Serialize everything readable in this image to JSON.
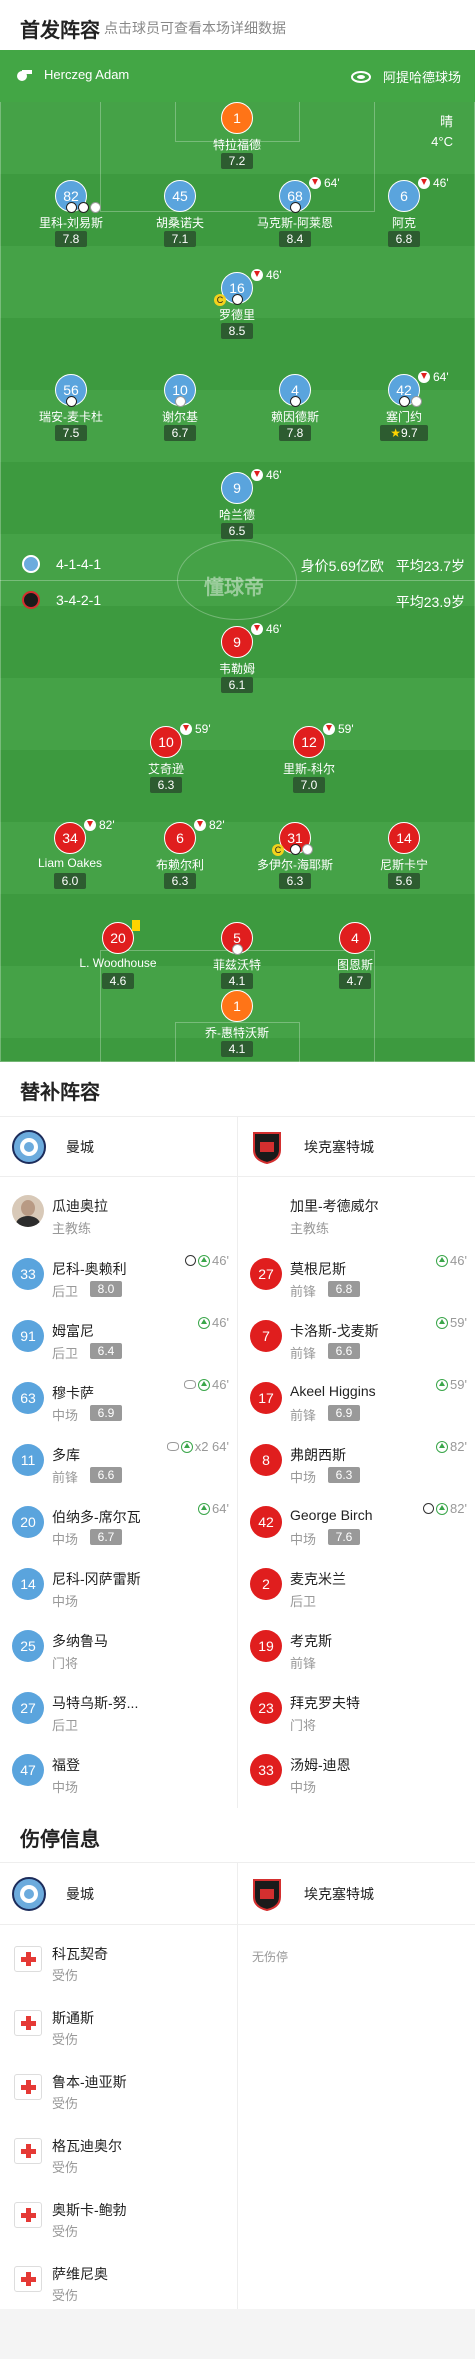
{
  "header": {
    "title": "首发阵容",
    "subtitle": "点击球员可查看本场详细数据"
  },
  "pitch": {
    "referee": "Herczeg Adam",
    "stadium": "阿提哈德球场",
    "weather": {
      "condition": "晴",
      "temperature": "4°C"
    },
    "watermark": "懂球帝",
    "home_team": {
      "name": "曼城",
      "formation": "4-1-4-1",
      "value": "身价5.69亿欧",
      "age": "平均23.7岁"
    },
    "away_team": {
      "name": "埃克塞特城",
      "formation": "3-4-2-1",
      "age": "平均23.9岁"
    },
    "home_players": [
      {
        "num": "1",
        "name": "特拉福德",
        "rating": "7.2",
        "color": "orange"
      },
      {
        "num": "82",
        "name": "里科-刘易斯",
        "rating": "7.8",
        "color": "blue"
      },
      {
        "num": "45",
        "name": "胡桑诺夫",
        "rating": "7.1",
        "color": "blue"
      },
      {
        "num": "68",
        "name": "马克斯-阿莱恩",
        "rating": "8.4",
        "color": "blue",
        "sub": "64'"
      },
      {
        "num": "6",
        "name": "阿克",
        "rating": "6.8",
        "color": "blue",
        "sub": "46'"
      },
      {
        "num": "16",
        "name": "罗德里",
        "rating": "8.5",
        "color": "blue",
        "sub": "46'"
      },
      {
        "num": "56",
        "name": "瑞安-麦卡杜",
        "rating": "7.5",
        "color": "blue"
      },
      {
        "num": "10",
        "name": "谢尔基",
        "rating": "6.7",
        "color": "blue"
      },
      {
        "num": "4",
        "name": "赖因德斯",
        "rating": "7.8",
        "color": "blue"
      },
      {
        "num": "42",
        "name": "塞门约",
        "rating": "9.7",
        "color": "blue",
        "sub": "64'"
      },
      {
        "num": "9",
        "name": "哈兰德",
        "rating": "6.5",
        "color": "blue",
        "sub": "46'"
      }
    ],
    "away_players": [
      {
        "num": "9",
        "name": "韦勒姆",
        "rating": "6.1",
        "color": "red",
        "sub": "46'"
      },
      {
        "num": "10",
        "name": "艾奇逊",
        "rating": "6.3",
        "color": "red",
        "sub": "59'"
      },
      {
        "num": "12",
        "name": "里斯-科尔",
        "rating": "7.0",
        "color": "red",
        "sub": "59'"
      },
      {
        "num": "34",
        "name": "Liam Oakes",
        "rating": "6.0",
        "color": "red",
        "sub": "82'"
      },
      {
        "num": "6",
        "name": "布赖尔利",
        "rating": "6.3",
        "color": "red",
        "sub": "82'"
      },
      {
        "num": "31",
        "name": "多伊尔-海耶斯",
        "rating": "6.3",
        "color": "red"
      },
      {
        "num": "14",
        "name": "尼斯卡宁",
        "rating": "5.6",
        "color": "red"
      },
      {
        "num": "20",
        "name": "L. Woodhouse",
        "rating": "4.6",
        "color": "red"
      },
      {
        "num": "5",
        "name": "菲兹沃特",
        "rating": "4.1",
        "color": "red"
      },
      {
        "num": "4",
        "name": "图恩斯",
        "rating": "4.7",
        "color": "red"
      },
      {
        "num": "1",
        "name": "乔-惠特沃斯",
        "rating": "4.1",
        "color": "orange"
      }
    ]
  },
  "subs": {
    "title": "替补阵容",
    "home": {
      "team": "曼城",
      "coach": {
        "name": "瓜迪奥拉",
        "role": "主教练"
      },
      "players": [
        {
          "num": "33",
          "name": "尼科-奥赖利",
          "pos": "后卫",
          "rating": "8.0",
          "event": "46'"
        },
        {
          "num": "91",
          "name": "姆富尼",
          "pos": "后卫",
          "rating": "6.4",
          "event": "46'"
        },
        {
          "num": "63",
          "name": "穆卡萨",
          "pos": "中场",
          "rating": "6.9",
          "event": "46'"
        },
        {
          "num": "11",
          "name": "多库",
          "pos": "前锋",
          "rating": "6.6",
          "event": "x2 64'"
        },
        {
          "num": "20",
          "name": "伯纳多-席尔瓦",
          "pos": "中场",
          "rating": "6.7",
          "event": "64'"
        },
        {
          "num": "14",
          "name": "尼科-冈萨雷斯",
          "pos": "中场",
          "rating": "",
          "event": ""
        },
        {
          "num": "25",
          "name": "多纳鲁马",
          "pos": "门将",
          "rating": "",
          "event": ""
        },
        {
          "num": "27",
          "name": "马特乌斯-努...",
          "pos": "后卫",
          "rating": "",
          "event": ""
        },
        {
          "num": "47",
          "name": "福登",
          "pos": "中场",
          "rating": "",
          "event": ""
        }
      ]
    },
    "away": {
      "team": "埃克塞特城",
      "coach": {
        "name": "加里-考德威尔",
        "role": "主教练"
      },
      "players": [
        {
          "num": "27",
          "name": "莫根尼斯",
          "pos": "前锋",
          "rating": "6.8",
          "event": "46'"
        },
        {
          "num": "7",
          "name": "卡洛斯-戈麦斯",
          "pos": "前锋",
          "rating": "6.6",
          "event": "59'"
        },
        {
          "num": "17",
          "name": "Akeel Higgins",
          "pos": "前锋",
          "rating": "6.9",
          "event": "59'"
        },
        {
          "num": "8",
          "name": "弗朗西斯",
          "pos": "中场",
          "rating": "6.3",
          "event": "82'"
        },
        {
          "num": "42",
          "name": "George Birch",
          "pos": "中场",
          "rating": "7.6",
          "event": "82'"
        },
        {
          "num": "2",
          "name": "麦克米兰",
          "pos": "后卫",
          "rating": "",
          "event": ""
        },
        {
          "num": "19",
          "name": "考克斯",
          "pos": "前锋",
          "rating": "",
          "event": ""
        },
        {
          "num": "23",
          "name": "拜克罗夫特",
          "pos": "门将",
          "rating": "",
          "event": ""
        },
        {
          "num": "33",
          "name": "汤姆-迪恩",
          "pos": "中场",
          "rating": "",
          "event": ""
        }
      ]
    }
  },
  "injuries": {
    "title": "伤停信息",
    "home_team": "曼城",
    "away_team": "埃克塞特城",
    "away_empty": "无伤停",
    "home": [
      {
        "name": "科瓦契奇",
        "status": "受伤"
      },
      {
        "name": "斯通斯",
        "status": "受伤"
      },
      {
        "name": "鲁本-迪亚斯",
        "status": "受伤"
      },
      {
        "name": "格瓦迪奥尔",
        "status": "受伤"
      },
      {
        "name": "奥斯卡-鲍勃",
        "status": "受伤"
      },
      {
        "name": "萨维尼奥",
        "status": "受伤"
      }
    ]
  },
  "colors": {
    "pitch": "#3d9a3f",
    "home": "#5aa4dd",
    "away": "#e01e1e",
    "keeper": "#ff7417"
  }
}
